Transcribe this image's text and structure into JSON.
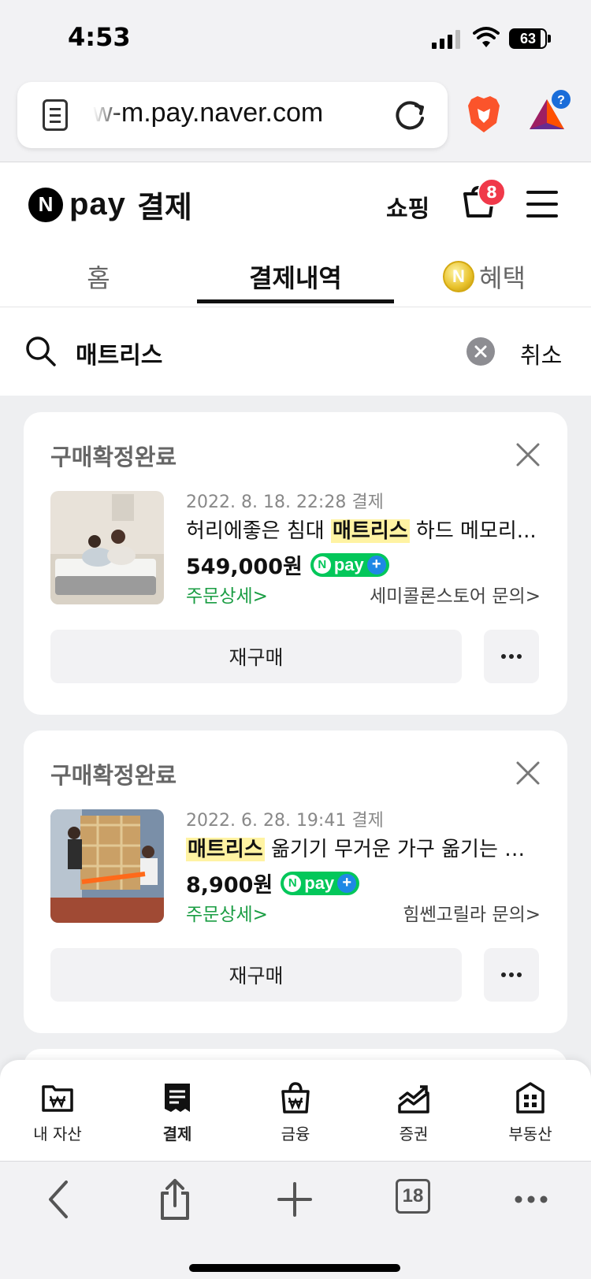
{
  "status_bar": {
    "time": "4:53",
    "battery": "63"
  },
  "browser": {
    "url": "w-m.pay.naver.com",
    "tab_count": "18"
  },
  "header": {
    "logo_mark": "N",
    "logo_pay": "pay",
    "logo_sub": "결제",
    "shop_label": "쇼핑",
    "cart_badge": "8",
    "tabs": [
      {
        "label": "홈"
      },
      {
        "label": "결제내역"
      },
      {
        "label": "혜택"
      }
    ],
    "coin_mark": "N"
  },
  "search": {
    "query": "매트리스",
    "cancel_label": "취소"
  },
  "orders": [
    {
      "status": "구매확정완료",
      "date": "2022. 8. 18. 22:28 결제",
      "title_prefix": "허리에좋은 침대 ",
      "title_highlight": "매트리스",
      "title_suffix": " 하드 메모리...",
      "price": "549,000원",
      "detail_link": "주문상세>",
      "seller_link": "세미콜론스토어 문의>",
      "rebuy_label": "재구매"
    },
    {
      "status": "구매확정완료",
      "date": "2022. 6. 28. 19:41 결제",
      "title_prefix": "",
      "title_highlight": "매트리스",
      "title_suffix": " 옮기기 무거운 가구 옮기는 기...",
      "price": "8,900원",
      "detail_link": "주문상세>",
      "seller_link": "힘쎈고릴라 문의>",
      "rebuy_label": "재구매"
    }
  ],
  "npay_badge": {
    "n": "N",
    "text": "pay",
    "plus": "+"
  },
  "bottom_nav": [
    {
      "label": "내 자산",
      "icon": "wallet-icon"
    },
    {
      "label": "결제",
      "icon": "receipt-icon"
    },
    {
      "label": "금융",
      "icon": "bag-icon"
    },
    {
      "label": "증권",
      "icon": "chart-icon"
    },
    {
      "label": "부동산",
      "icon": "building-icon"
    }
  ],
  "colors": {
    "accent_green": "#03c75a",
    "highlight": "#fff3a3",
    "badge_red": "#f0394a"
  }
}
